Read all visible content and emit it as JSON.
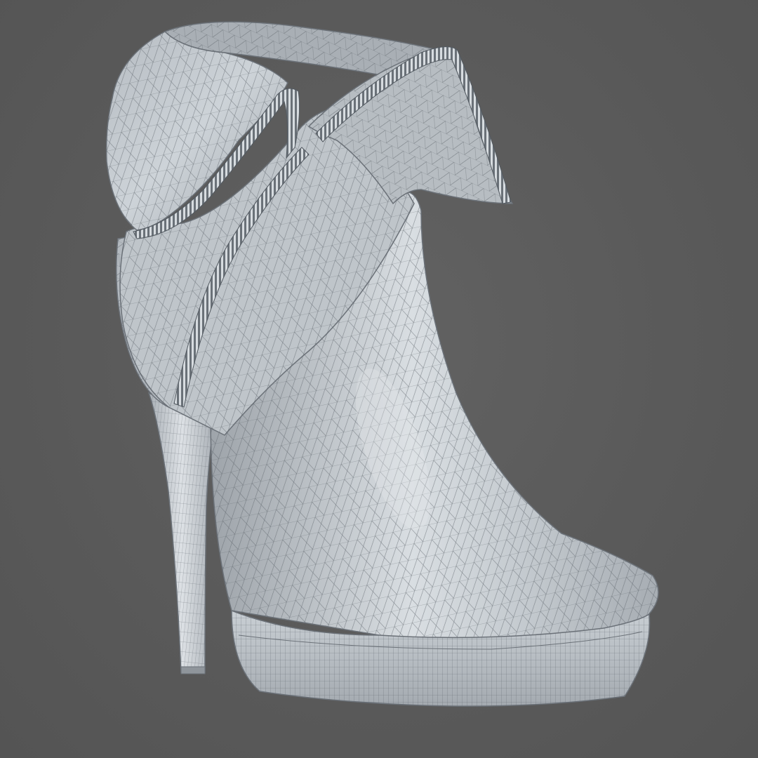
{
  "viewport": {
    "background_color": "#5b5b5b"
  },
  "model": {
    "subject": "high-heel-platform-ankle-boot",
    "render_style": "wireframe-on-shaded",
    "surface_color": "#c2c8ce",
    "shadow_color": "#8e949a",
    "highlight_color": "#e4e8ec",
    "wire_color": "#5d646b",
    "parts": [
      "fold-over-cuff",
      "side-zipper",
      "upper",
      "platform",
      "stiletto-heel",
      "cuff-zipper"
    ]
  }
}
